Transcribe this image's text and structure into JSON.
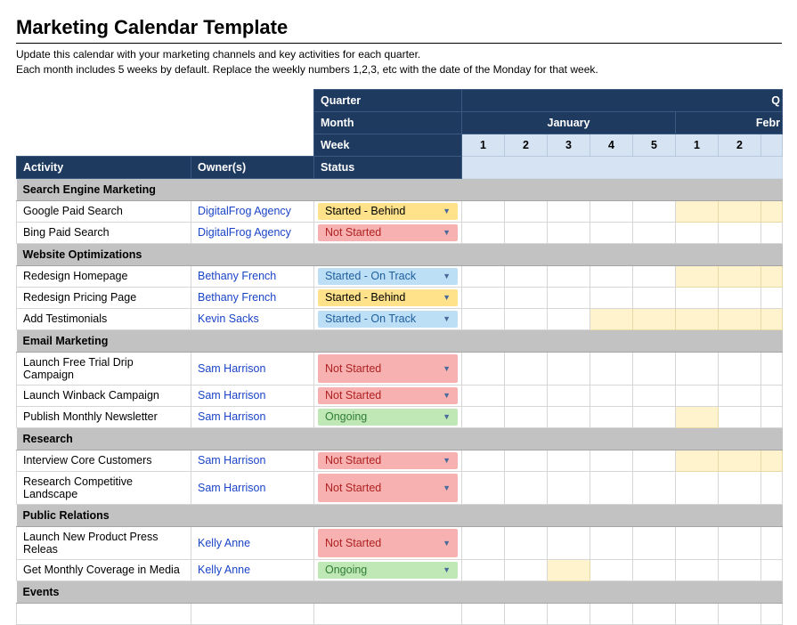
{
  "title": "Marketing Calendar Template",
  "instructions": {
    "line1": "Update this calendar with your marketing channels and key activities for each quarter.",
    "line2": "Each month includes 5 weeks by default. Replace the weekly numbers 1,2,3, etc with the date of the Monday for that week."
  },
  "headers": {
    "quarter": "Quarter",
    "quarter_cut": "Q",
    "month": "Month",
    "week": "Week",
    "activity": "Activity",
    "owner": "Owner(s)",
    "status": "Status"
  },
  "months": {
    "january": "January",
    "february_cut": "Febr"
  },
  "weeks": {
    "w1": "1",
    "w2": "2",
    "w3": "3",
    "w4": "4",
    "w5": "5",
    "wb1": "1",
    "wb2": "2",
    "wb3": ""
  },
  "status_labels": {
    "behind": "Started - Behind",
    "not_started": "Not Started",
    "on_track": "Started - On Track",
    "ongoing": "Ongoing"
  },
  "sections": {
    "sem": "Search Engine Marketing",
    "web": "Website Optimizations",
    "email": "Email Marketing",
    "research": "Research",
    "pr": "Public Relations",
    "events": "Events"
  },
  "rows": {
    "google": {
      "activity": "Google Paid Search",
      "owner": "DigitalFrog Agency"
    },
    "bing": {
      "activity": "Bing Paid Search",
      "owner": "DigitalFrog Agency"
    },
    "home": {
      "activity": "Redesign Homepage",
      "owner": "Bethany French"
    },
    "pricing": {
      "activity": "Redesign Pricing Page",
      "owner": "Bethany French"
    },
    "testi": {
      "activity": "Add Testimonials",
      "owner": "Kevin Sacks"
    },
    "drip": {
      "activity": "Launch Free Trial Drip Campaign",
      "owner": "Sam Harrison"
    },
    "winback": {
      "activity": "Launch Winback Campaign",
      "owner": "Sam Harrison"
    },
    "news": {
      "activity": "Publish Monthly Newsletter",
      "owner": "Sam Harrison"
    },
    "interv": {
      "activity": "Interview Core Customers",
      "owner": "Sam Harrison"
    },
    "comp": {
      "activity": "Research Competitive Landscape",
      "owner": "Sam Harrison"
    },
    "press": {
      "activity": "Launch New Product Press Releas",
      "owner": "Kelly Anne"
    },
    "cover": {
      "activity": "Get Monthly Coverage in Media",
      "owner": "Kelly Anne"
    }
  }
}
